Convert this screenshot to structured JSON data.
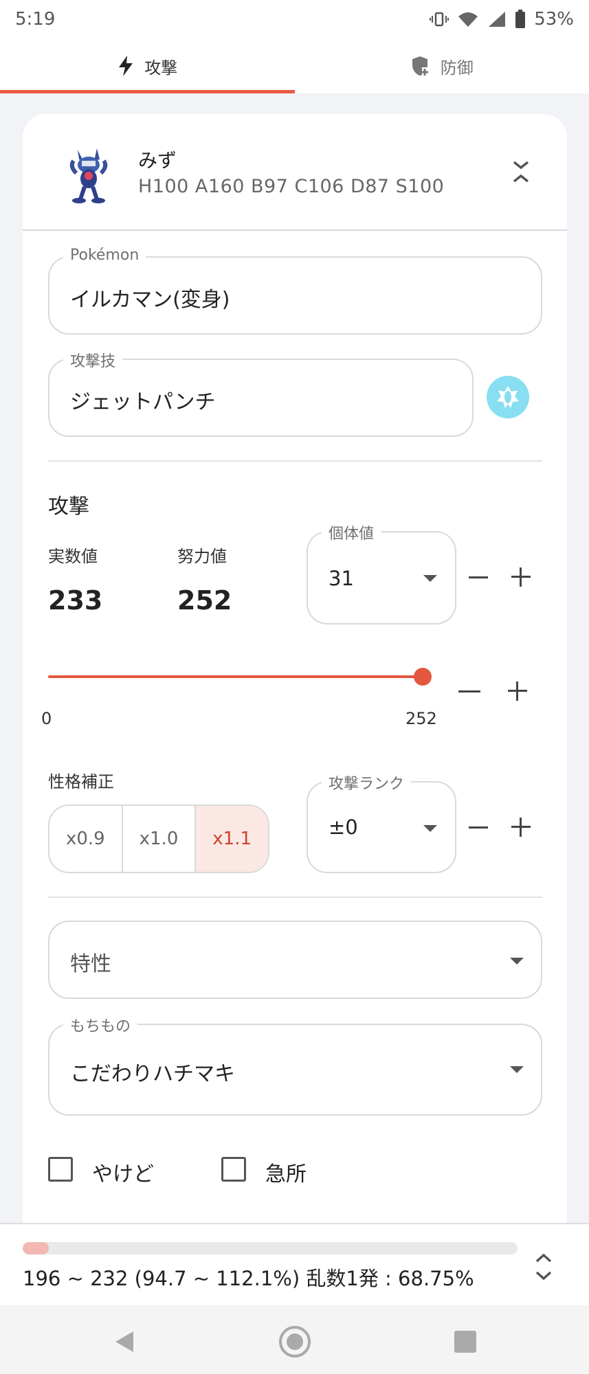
{
  "status": {
    "time": "5:19",
    "battery": "53%"
  },
  "tabs": [
    {
      "label": "攻撃",
      "icon": "lightning-icon",
      "active": true
    },
    {
      "label": "防御",
      "icon": "shield-plus-icon",
      "active": false
    }
  ],
  "pokemon_card": {
    "name": "みず",
    "stats": "H100 A160 B97 C106 D87 S100"
  },
  "fields": {
    "pokemon_label": "Pokémon",
    "pokemon_value": "イルカマン(変身)",
    "move_label": "攻撃技",
    "move_value": "ジェットパンチ",
    "move_type": "water"
  },
  "attack": {
    "title": "攻撃",
    "actual_label": "実数値",
    "actual_value": "233",
    "ev_label": "努力値",
    "ev_value": "252",
    "iv_label": "個体値",
    "iv_value": "31",
    "slider_min": "0",
    "slider_max": "252",
    "slider_value": 252
  },
  "nature": {
    "label": "性格補正",
    "options": [
      "x0.9",
      "x1.0",
      "x1.1"
    ],
    "selected": "x1.1"
  },
  "rank": {
    "label": "攻撃ランク",
    "value": "±0"
  },
  "ability": {
    "placeholder": "特性"
  },
  "item": {
    "label": "もちもの",
    "value": "こだわりハチマキ"
  },
  "conditions": [
    {
      "label": "やけど",
      "checked": false
    },
    {
      "label": "急所",
      "checked": false
    }
  ],
  "result": {
    "text": "196 ~ 232 (94.7 ~ 112.1%) 乱数1発 : 68.75%",
    "min_percent": 94.7,
    "max_percent": 112.1
  },
  "colors": {
    "accent": "#e4573f",
    "water_type": "#87dff1"
  }
}
